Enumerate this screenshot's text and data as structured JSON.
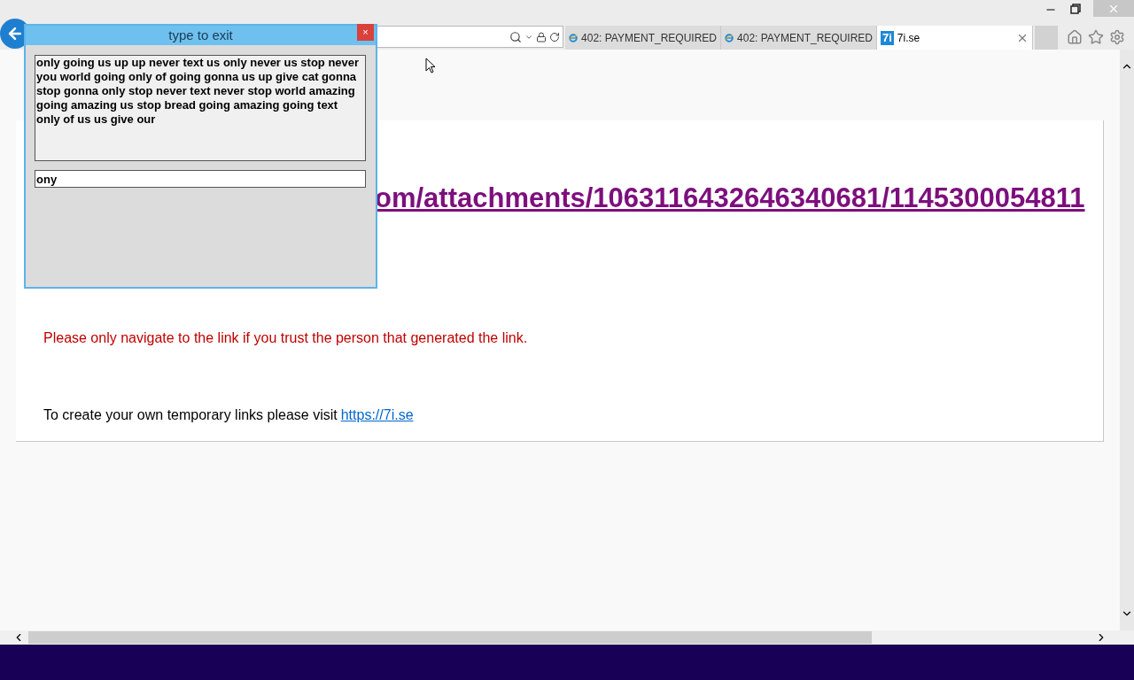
{
  "browser": {
    "tabs": [
      {
        "title": "402: PAYMENT_REQUIRED",
        "selected": false,
        "kind": "ie"
      },
      {
        "title": "402: PAYMENT_REQUIRED",
        "selected": false,
        "kind": "ie"
      },
      {
        "title": "7i.se",
        "selected": true,
        "kind": "site",
        "favicon": "7i"
      }
    ]
  },
  "page": {
    "link": "om/attachments/1063116432646340681/1145300054811",
    "warning": "Please only navigate to the link if you trust the person that generated the link.",
    "footer": {
      "text": "To create your own temporary links please visit",
      "link": "https://7i.se"
    }
  },
  "dialog": {
    "title": "type to exit",
    "close": "×",
    "message": "only going us up up never text us only never us stop never you world going only of going gonna us up give cat gonna stop gonna only stop never text never stop world amazing going amazing us stop bread going amazing going text only of us us give our",
    "input": "ony"
  }
}
